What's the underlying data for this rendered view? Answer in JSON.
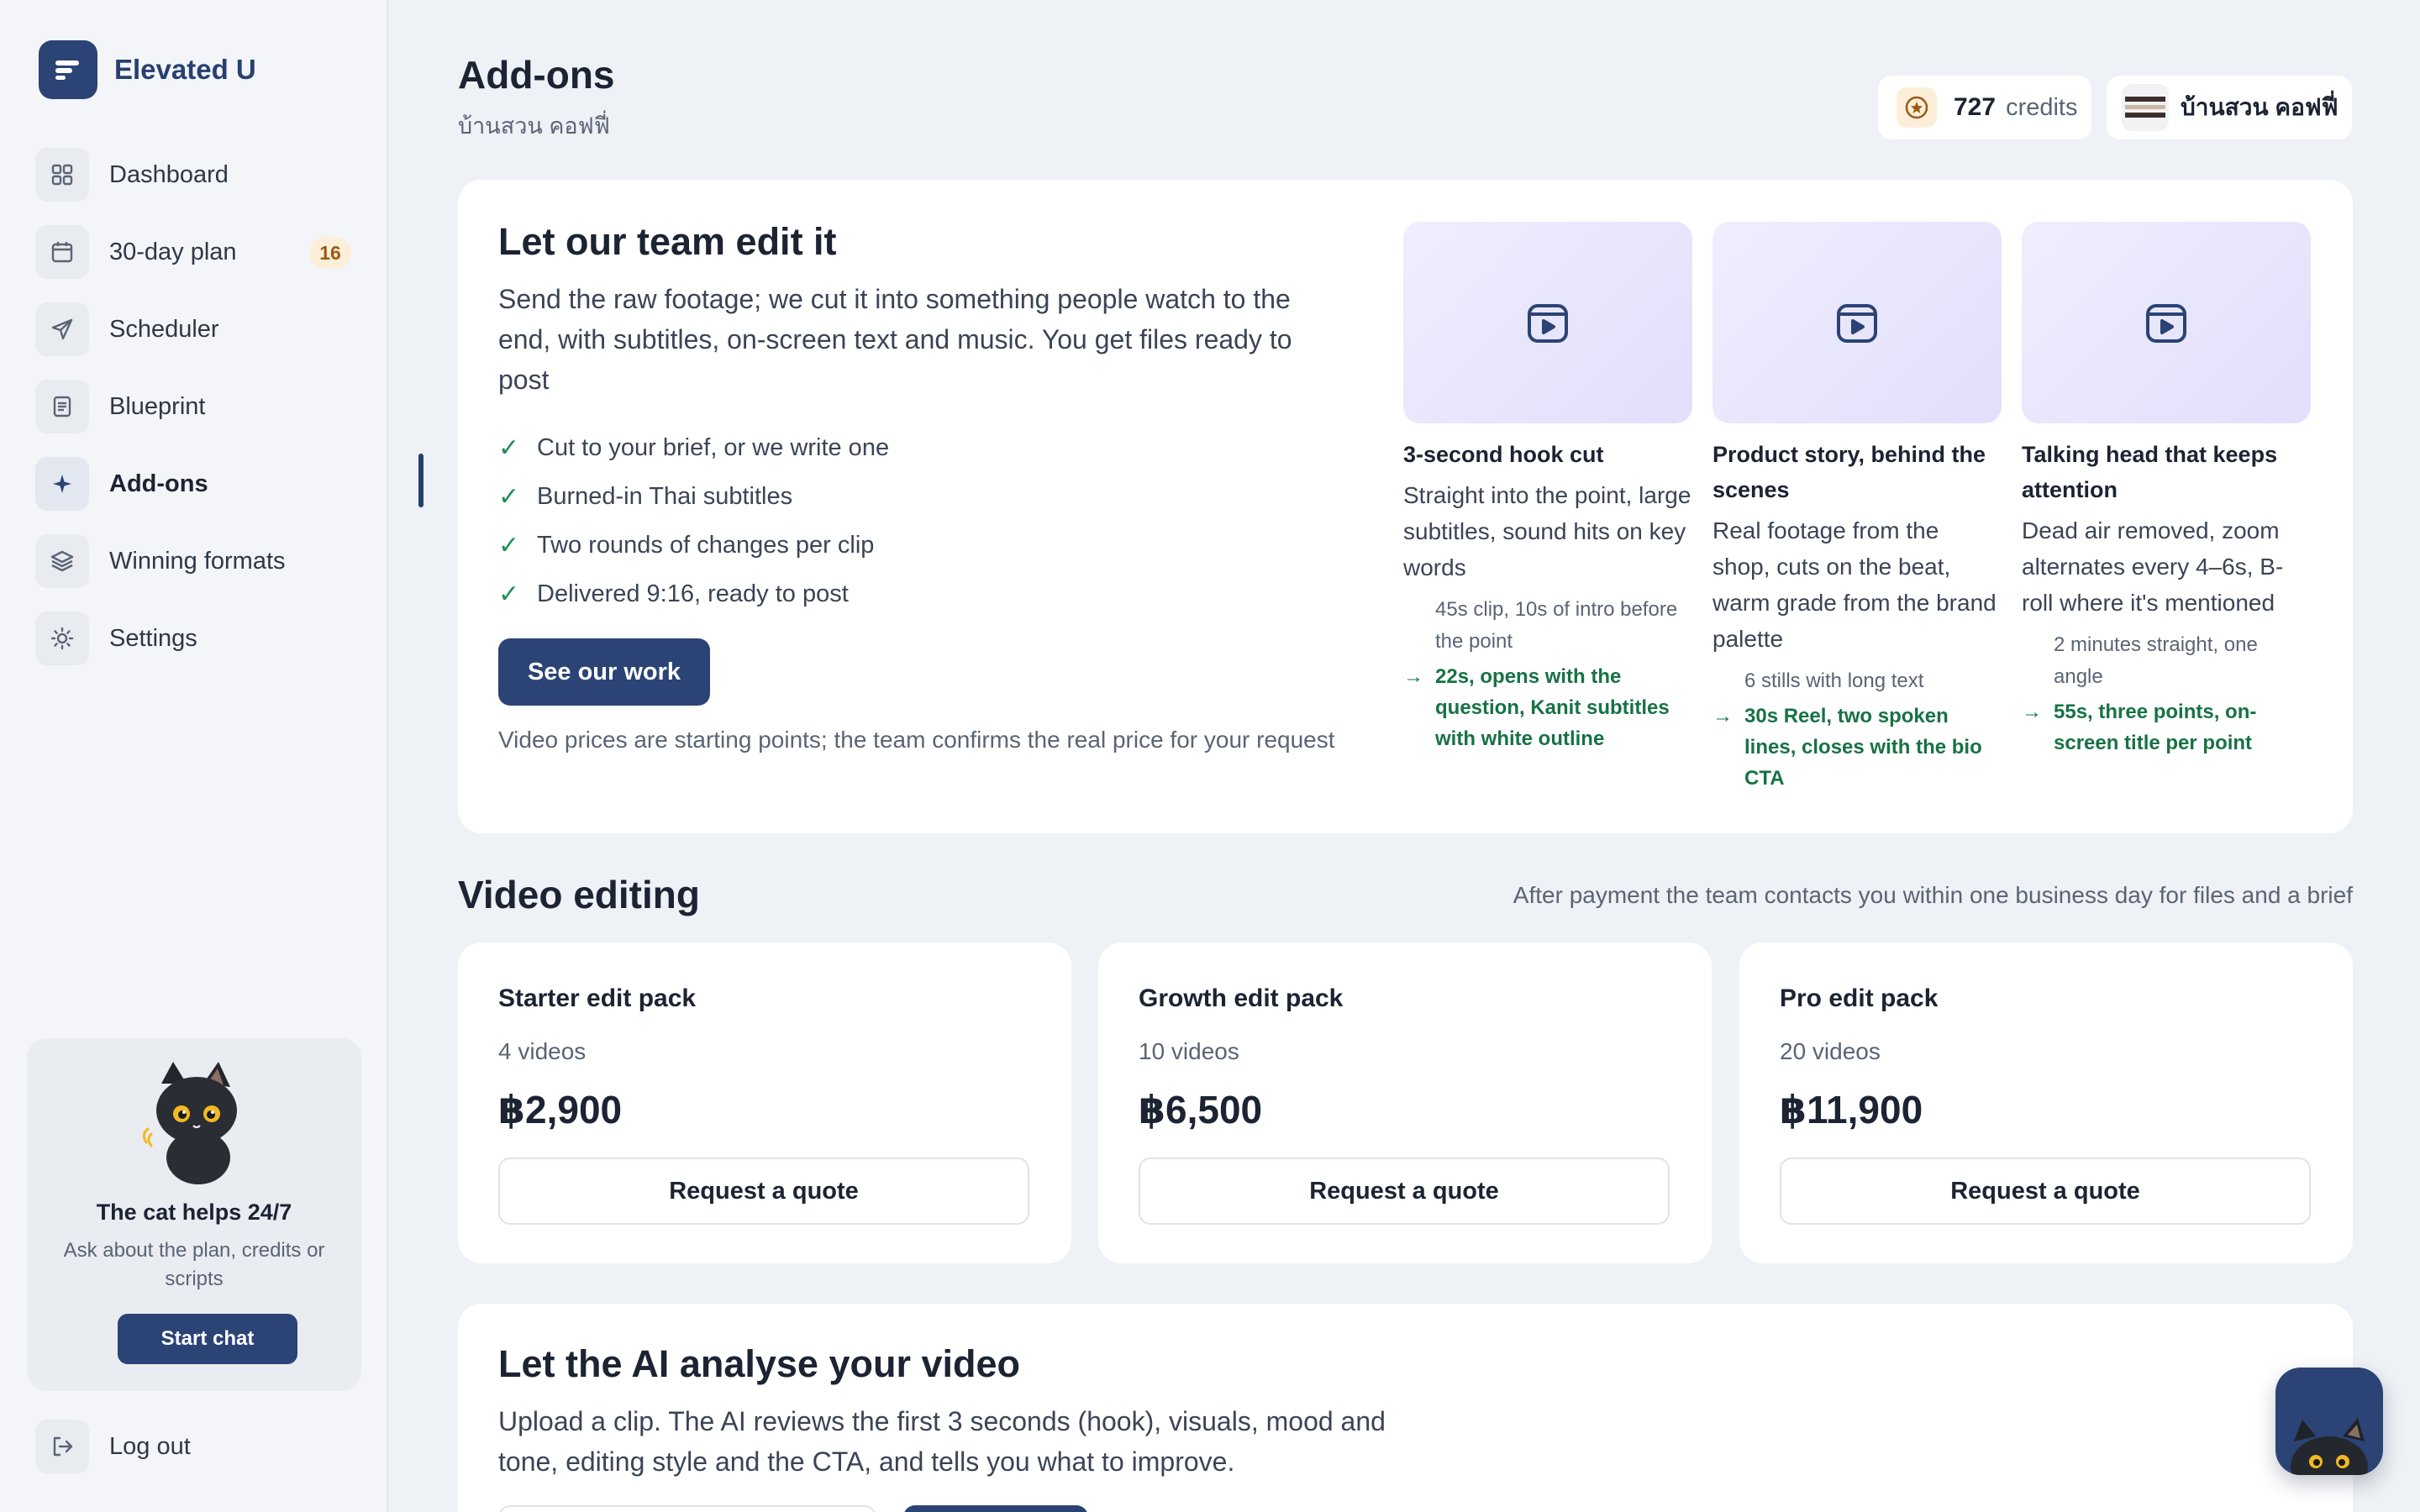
{
  "brand": {
    "name": "Elevated U"
  },
  "sidebar": {
    "items": [
      {
        "label": "Dashboard",
        "icon": "grid-icon"
      },
      {
        "label": "30-day plan",
        "icon": "calendar-icon",
        "badge": "16"
      },
      {
        "label": "Scheduler",
        "icon": "send-icon"
      },
      {
        "label": "Blueprint",
        "icon": "document-icon"
      },
      {
        "label": "Add-ons",
        "icon": "sparkle-icon",
        "active": true
      },
      {
        "label": "Winning formats",
        "icon": "layers-icon"
      },
      {
        "label": "Settings",
        "icon": "gear-icon"
      }
    ],
    "cat_card": {
      "title": "The cat helps 24/7",
      "subtitle": "Ask about the plan, credits or scripts",
      "button": "Start chat"
    },
    "logout": "Log out"
  },
  "header": {
    "title": "Add-ons",
    "subtitle": "บ้านสวน คอฟฟี่",
    "credits_value": "727",
    "credits_label": "credits",
    "shop_name": "บ้านสวน คอฟฟี่"
  },
  "team_edit": {
    "title": "Let our team edit it",
    "description": "Send the raw footage; we cut it into something people watch to the end, with subtitles, on-screen text and music. You get files ready to post",
    "bullets": [
      "Cut to your brief, or we write one",
      "Burned-in Thai subtitles",
      "Two rounds of changes per clip",
      "Delivered 9:16, ready to post"
    ],
    "button": "See our work",
    "note": "Video prices are starting points; the team confirms the real price for your request",
    "samples": [
      {
        "title": "3-second hook cut",
        "description": "Straight into the point, large subtitles, sound hits on key words",
        "before": "45s clip, 10s of intro before the point",
        "after": "22s, opens with the question, Kanit subtitles with white outline"
      },
      {
        "title": "Product story, behind the scenes",
        "description": "Real footage from the shop, cuts on the beat, warm grade from the brand palette",
        "before": "6 stills with long text",
        "after": "30s Reel, two spoken lines, closes with the bio CTA"
      },
      {
        "title": "Talking head that keeps attention",
        "description": "Dead air removed, zoom alternates every 4–6s, B-roll where it's mentioned",
        "before": "2 minutes straight, one angle",
        "after": "55s, three points, on-screen title per point"
      }
    ]
  },
  "video_editing": {
    "title": "Video editing",
    "note": "After payment the team contacts you within one business day for files and a brief",
    "packs": [
      {
        "name": "Starter edit pack",
        "count": "4 videos",
        "price": "฿2,900",
        "button": "Request a quote"
      },
      {
        "name": "Growth edit pack",
        "count": "10 videos",
        "price": "฿6,500",
        "button": "Request a quote"
      },
      {
        "name": "Pro edit pack",
        "count": "20 videos",
        "price": "฿11,900",
        "button": "Request a quote"
      }
    ]
  },
  "ai_analyse": {
    "title": "Let the AI analyse your video",
    "description": "Upload a clip. The AI reviews the first 3 seconds (hook), visuals, mood and tone, editing style and the CTA, and tells you what to improve."
  },
  "colors": {
    "brand": "#2b4375",
    "background": "#eef1f5",
    "success": "#177245",
    "badge_bg": "#fcefd9"
  }
}
